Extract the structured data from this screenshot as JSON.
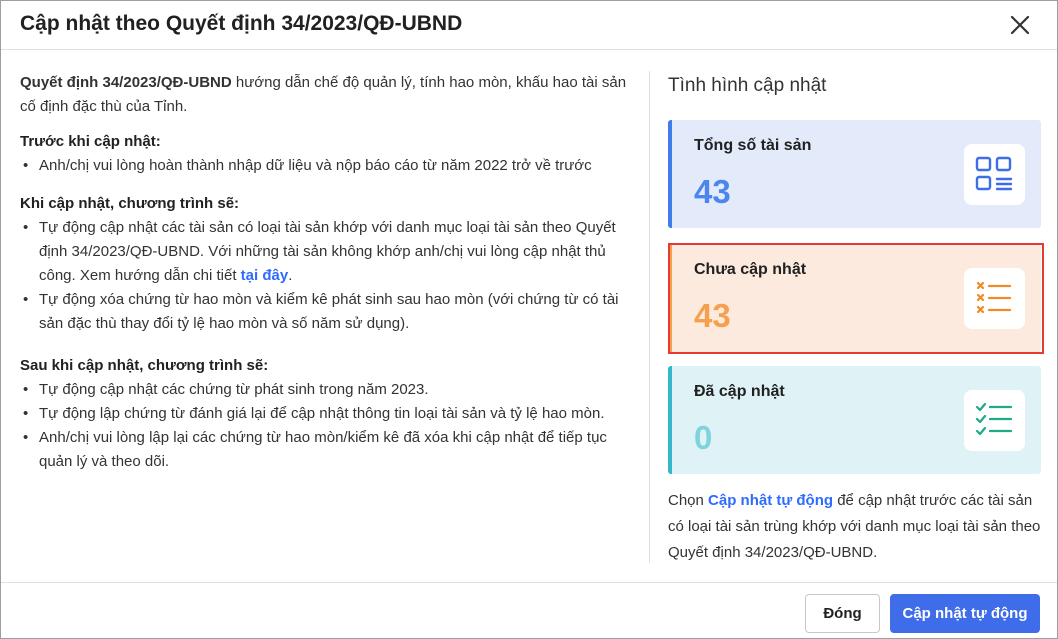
{
  "dialog": {
    "title": "Cập nhật theo Quyết định 34/2023/QĐ-UBND"
  },
  "intro": {
    "bold": "Quyết định 34/2023/QĐ-UBND",
    "text": " hướng dẫn chế độ quản lý, tính hao mòn, khấu hao tài sản cố định đặc thù của Tỉnh."
  },
  "before": {
    "title": "Trước khi cập nhật:",
    "items": [
      "Anh/chị vui lòng hoàn thành nhập dữ liệu và nộp báo cáo từ năm 2022 trở về trước"
    ]
  },
  "during": {
    "title": "Khi cập nhật, chương trình sẽ:",
    "item1_text": "Tự động cập nhật các tài sản có loại tài sản khớp với danh mục loại tài sản theo Quyết định 34/2023/QĐ-UBND. Với những tài sản không khớp anh/chị vui lòng cập nhật thủ công. Xem hướng dẫn chi tiết ",
    "item1_link": "tại đây",
    "item1_end": ".",
    "item2": "Tự động xóa chứng từ hao mòn và kiểm kê phát sinh sau hao mòn (với chứng từ có tài sản đặc thù thay đổi tỷ lệ hao mòn và số năm sử dụng)."
  },
  "after": {
    "title": "Sau khi cập nhật, chương trình sẽ:",
    "items": [
      "Tự động cập nhật các chứng từ phát sinh trong năm 2023.",
      "Tự động lập chứng từ đánh giá lại để cập nhật thông tin loại tài sản và tỷ lệ hao mòn.",
      "Anh/chị vui lòng lập lại các chứng từ hao mòn/kiểm kê đã xóa khi cập nhật để tiếp tục quản lý và theo dõi."
    ]
  },
  "status": {
    "title": "Tình hình cập nhật",
    "total": {
      "label": "Tổng số tài sản",
      "value": "43",
      "color": "#3f7dea",
      "icon": "grid-list-icon"
    },
    "pending": {
      "label": "Chưa cập nhật",
      "value": "43",
      "color": "#f6a04d",
      "icon": "x-list-icon"
    },
    "done": {
      "label": "Đã cập nhật",
      "value": "0",
      "color": "#7fd3dd",
      "icon": "check-list-icon"
    }
  },
  "note": {
    "prefix": "Chọn ",
    "link": "Cập nhật tự động",
    "suffix": " để cập nhật trước các tài sản có loại tài sản trùng khớp với danh mục loại tài sản theo Quyết định 34/2023/QĐ-UBND."
  },
  "footer": {
    "close_label": "Đóng",
    "primary_label": "Cập nhật tự động"
  }
}
